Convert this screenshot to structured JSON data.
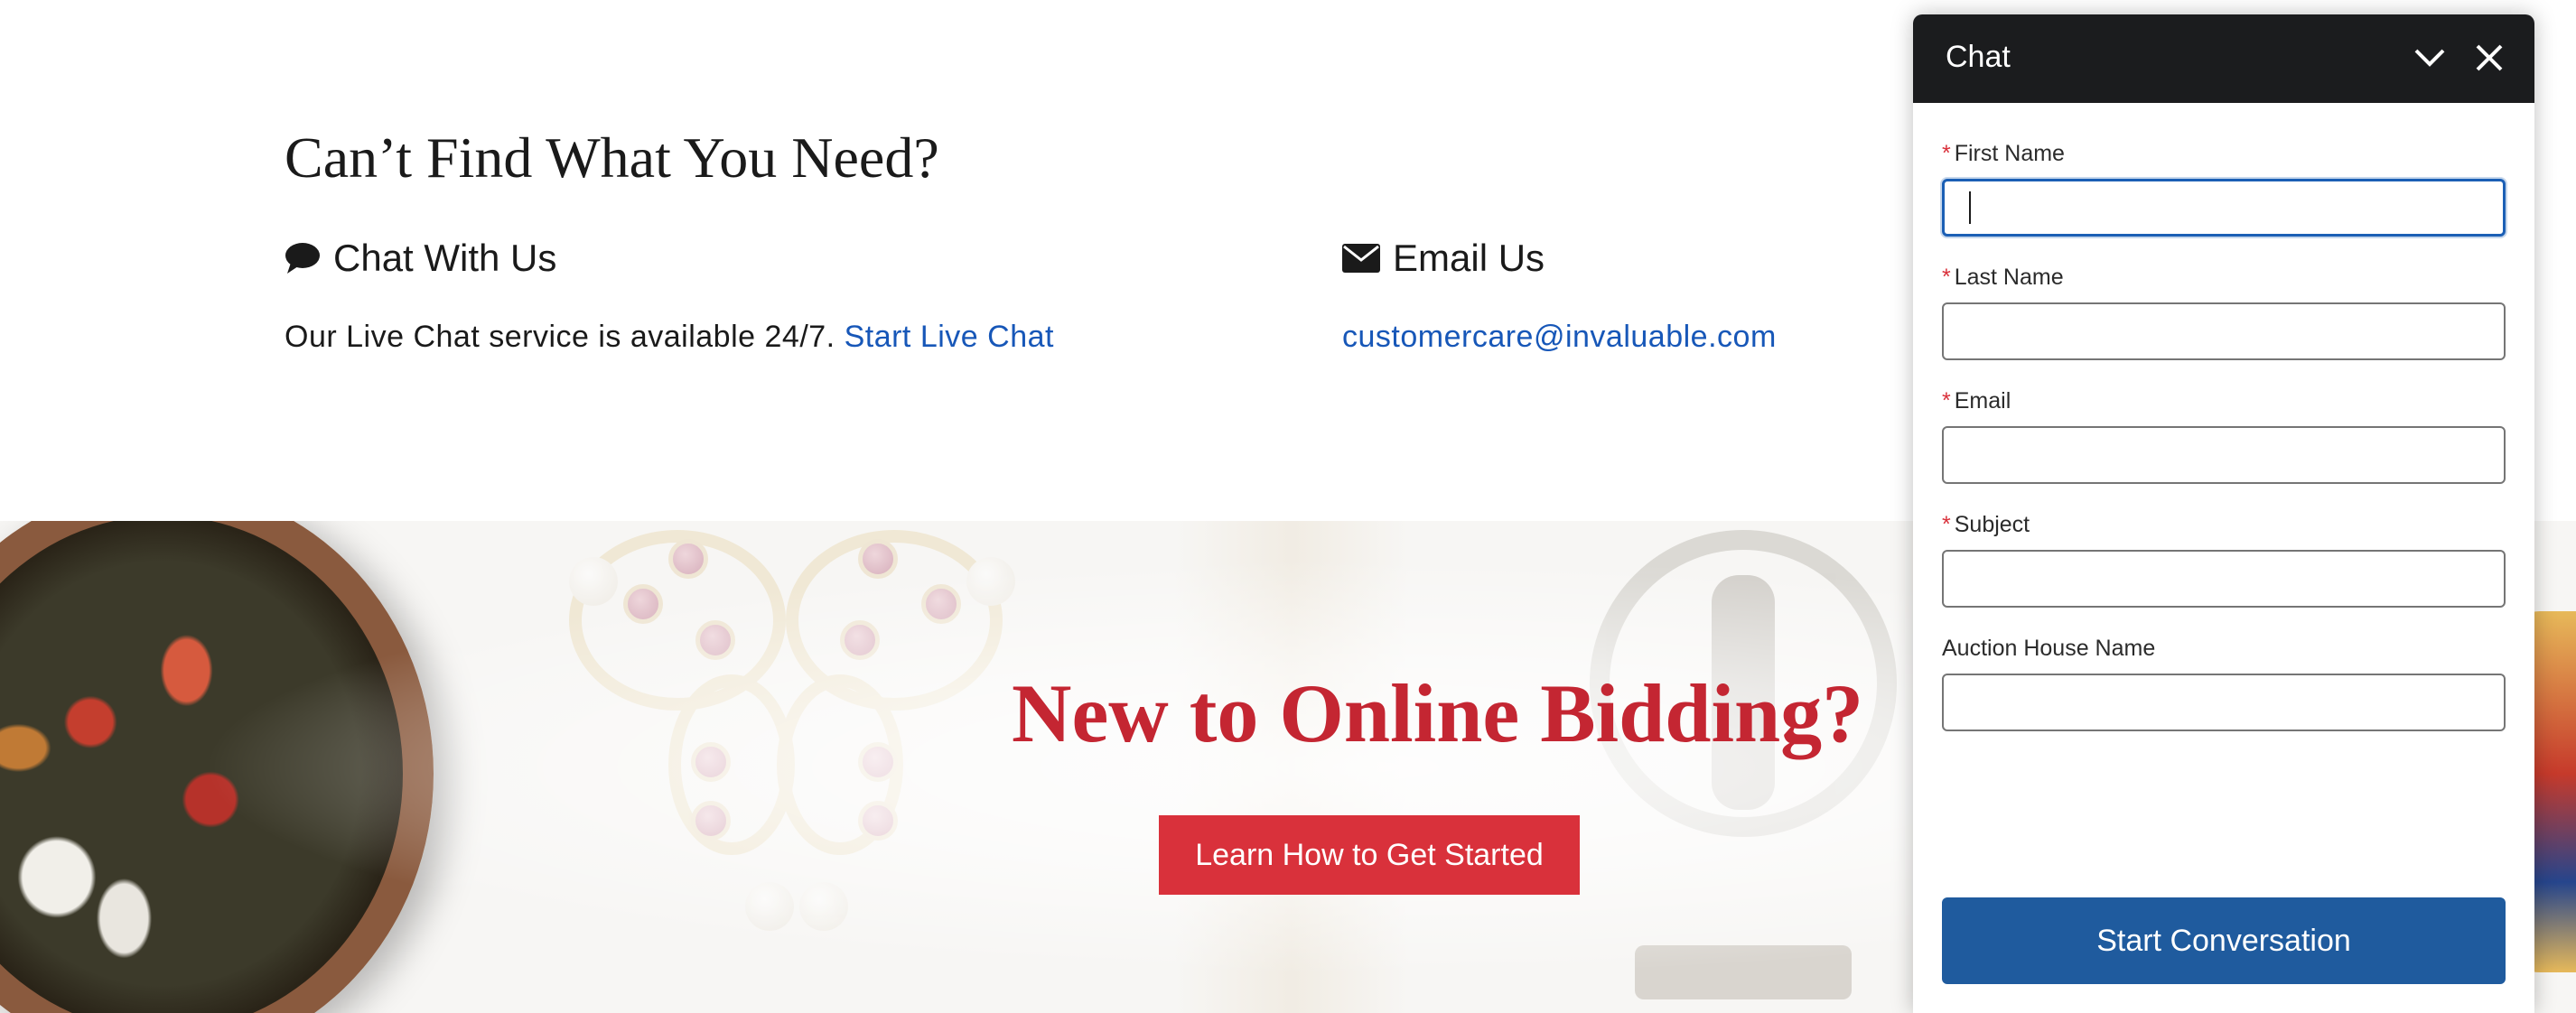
{
  "help": {
    "title": "Can’t Find What You Need?",
    "chat": {
      "heading": "Chat With Us",
      "icon": "speech-bubble-icon",
      "body_text": "Our Live Chat service is available 24/7.",
      "link_text": "Start Live Chat"
    },
    "email": {
      "heading": "Email Us",
      "icon": "envelope-icon",
      "address": "customercare@invaluable.com"
    }
  },
  "banner": {
    "title": "New to Online Bidding?",
    "cta_label": "Learn How to Get Started",
    "title_color": "#c42632",
    "cta_color": "#d9313b"
  },
  "chat_widget": {
    "title": "Chat",
    "minimize_icon": "chevron-down-icon",
    "close_icon": "close-icon",
    "fields": {
      "first_name": {
        "label": "First Name",
        "required_mark": "*",
        "value": ""
      },
      "last_name": {
        "label": "Last Name",
        "required_mark": "*",
        "value": ""
      },
      "email": {
        "label": "Email",
        "required_mark": "*",
        "value": ""
      },
      "subject": {
        "label": "Subject",
        "required_mark": "*",
        "value": ""
      },
      "auction_house": {
        "label": "Auction House Name",
        "value": ""
      }
    },
    "submit_label": "Start Conversation",
    "header_color": "#1b1c1e",
    "button_color": "#1f5b9e"
  },
  "colors": {
    "link": "#1757b8",
    "focus": "#1b5fb5"
  }
}
